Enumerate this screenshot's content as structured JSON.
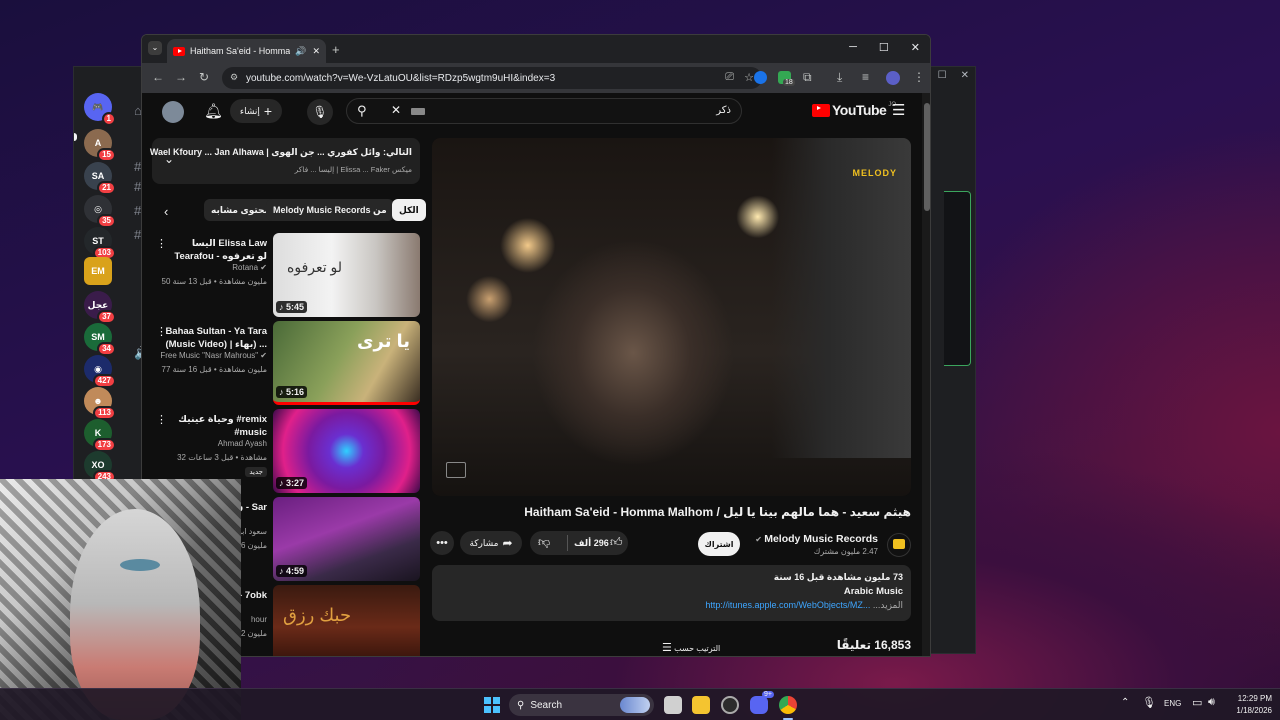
{
  "browser": {
    "tab_title": "Haitham Sa'eid - Homma M",
    "url": "youtube.com/watch?v=We-VzLatuOU&list=RDzp5wgtm9uHI&index=3",
    "extension_badge": "18"
  },
  "youtube": {
    "logo": "YouTube",
    "region": "JO",
    "search_value": "ذكر",
    "create_label": "إنشاء",
    "playlist": {
      "next_label": "التالي: وائل كفوري ... جن الهوى | Wael Kfoury ... Jan Alhawa",
      "subtitle": "ميكس Elissa ... Faker | إليسا ... فاكر"
    },
    "chips": [
      "الكل",
      "من Melody Music Records",
      "محتوى مشابه"
    ],
    "video": {
      "title": "هيثم سعيد - هما مالهم بينا يا ليل / Haitham Sa'eid - Homma Malhom",
      "channel": "Melody Music Records",
      "subscribers": "2.47 مليون مشترك",
      "subscribe_label": "اشتراك",
      "likes": "296 ألف",
      "share_label": "مشاركة",
      "views": "73 مليون مشاهدة  قبل 16 سنة",
      "category": "Arabic Music",
      "link": "http://itunes.apple.com/WebObjects/MZ...",
      "more_label": "...المزيد",
      "comments_count": "16,853 تعليقًا",
      "sort_label": "الترتيب حسب",
      "watermark": "MELODY"
    },
    "recommendations": [
      {
        "title": "اليسا Elissa Law Tearafou - لو تعرفوه",
        "channel": "Rotana",
        "meta": "50 مليون مشاهدة • قبل 13 سنة",
        "duration": "5:45",
        "thumb_text": "لو تعرفوه"
      },
      {
        "title": "Bahaa Sultan - Ya Tara (Music Video) | بهاء) ...",
        "channel": "Free Music \"Nasr Mahrous\"",
        "meta": "77 مليون مشاهدة • قبل 16 سنة",
        "duration": "5:16",
        "thumb_text": "يا ترى"
      },
      {
        "title": "وحياة عينيك #remix #music",
        "channel": "Ahmad Ayash",
        "meta": "32 مشاهدة • قبل 3 ساعات",
        "badge": "جديد",
        "duration": "3:27",
        "thumb_text": ""
      },
      {
        "title": "ن - Sar",
        "channel": "سعود ابو",
        "meta": "16 مليون",
        "duration": "4:59",
        "thumb_text": ""
      },
      {
        "title": "- 7obk",
        "channel": "hour",
        "meta": "32 مليون",
        "duration": "",
        "thumb_text": "حبك رزق"
      }
    ]
  },
  "discord": {
    "badges": [
      "1",
      "15",
      "21",
      "35",
      "103",
      "37",
      "34",
      "427",
      "113",
      "173",
      "243"
    ]
  },
  "taskbar": {
    "search_placeholder": "Search",
    "language": "ENG",
    "time": "12:29 PM",
    "date": "1/18/2026",
    "discord_badge": "9+"
  }
}
